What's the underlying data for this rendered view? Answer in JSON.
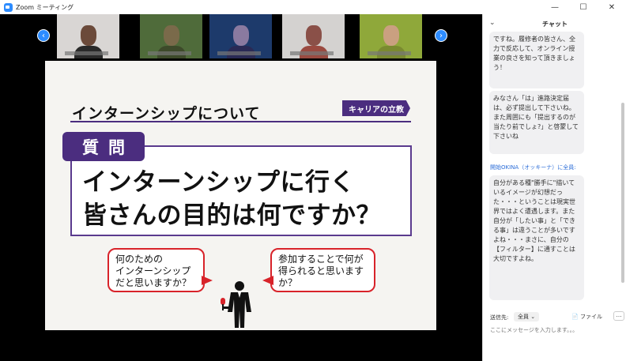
{
  "window": {
    "title": "Zoom ミーティング",
    "controls": {
      "minimize": "—",
      "maximize": "☐",
      "close": "✕"
    }
  },
  "gallery": {
    "prev": "‹",
    "next": "›",
    "thumbnails": [
      {
        "bg": "#d9d6d4",
        "face": "#6b4a3a",
        "body": "#2a2a2a"
      },
      {
        "bg": "#4f6b3a",
        "face": "#7a6a4a",
        "body": "#3d4a2a"
      },
      {
        "bg": "#1d3a6b",
        "face": "#8a7aa0",
        "body": "#2a2a55"
      },
      {
        "bg": "#d4d2d0",
        "face": "#8a5048",
        "body": "#9a4a40"
      },
      {
        "bg": "#8fa83a",
        "face": "#caa080",
        "body": "#7a8a30"
      }
    ]
  },
  "slide": {
    "title": "インターンシップについて",
    "brand": "キャリアの立教",
    "question_tab": "質問",
    "question_line1": "インターンシップに行く",
    "question_line2": "皆さんの目的は何ですか？",
    "bubble_left": "何のための\nインターンシップ\nだと思いますか？",
    "bubble_right": "参加することで何が\n得られると思います\nか？"
  },
  "chat": {
    "title": "チャット",
    "collapse": "⌄",
    "messages": [
      "ですね。履修者の皆さん、全力で反応して、オンライン授業の良さを知って頂きましょう！",
      "みなさん「は」進路決定届は、必ず提出して下さいね。また周囲にも「提出するのが当たり前でしょ?」と啓蒙して下さいね",
      "自分がある種\"勝手に\"描いているイメージが幻想だった・・・ということは現実世界ではよく遭遇します。また自分が「したい事」と「できる事」は違うことが多いですよね・・・まさに、自分の【フィルター】に通すことは大切ですよね。"
    ],
    "sender_line": "開始OKINA（オッキーナ）に全員:",
    "send_to_label": "送信先:",
    "recipient": "全員 ⌄",
    "file_label": "📄 ファイル",
    "more": "…",
    "input_placeholder": "ここにメッセージを入力します。。。"
  },
  "colors": {
    "accent": "#2d8cff",
    "slide_purple": "#4b2d7f",
    "bubble_red": "#d8232a"
  }
}
